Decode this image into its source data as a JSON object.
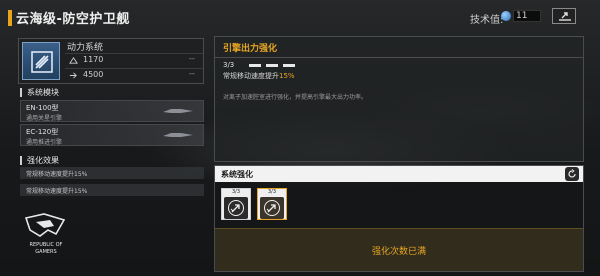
{
  "header": {
    "title": "云海级-防空护卫舰",
    "tech_label": "技术值:",
    "tech_value": "11",
    "share_icon": "share-icon"
  },
  "system": {
    "name": "动力系统",
    "icon": "power-system-icon",
    "stats": [
      {
        "icon": "hull-icon",
        "value": "1170",
        "extra": "--"
      },
      {
        "icon": "speed-icon",
        "value": "4500",
        "extra": "--"
      }
    ]
  },
  "modules": {
    "label": "系统模块",
    "items": [
      {
        "name": "EN-100型",
        "sub": "通用关星引擎"
      },
      {
        "name": "EC-120型",
        "sub": "通用推进引擎"
      }
    ]
  },
  "effects": {
    "label": "强化效果",
    "items": [
      "常规移动速度提升15%",
      "常规移动速度提升15%"
    ]
  },
  "brand": {
    "line1": "REPUBLIC OF",
    "line2": "GAMERS"
  },
  "upgrade": {
    "title": "引擎出力强化",
    "level": "3/3",
    "level_current": 3,
    "level_max": 3,
    "effect_prefix": "常规移动速度提升",
    "effect_value": "15%",
    "description": "对离子加速腔室进行强化，并提高引擎最大出力功率。"
  },
  "enhance": {
    "title": "系统强化",
    "slots": [
      {
        "level": "3/3",
        "icon": "engine-thrust-icon"
      },
      {
        "level": "3/3",
        "icon": "engine-thrust-icon"
      }
    ],
    "status": "强化次数已满"
  },
  "colors": {
    "accent": "#e7a623",
    "panel_border": "#4a4c4f",
    "text": "#d8d8d8"
  }
}
